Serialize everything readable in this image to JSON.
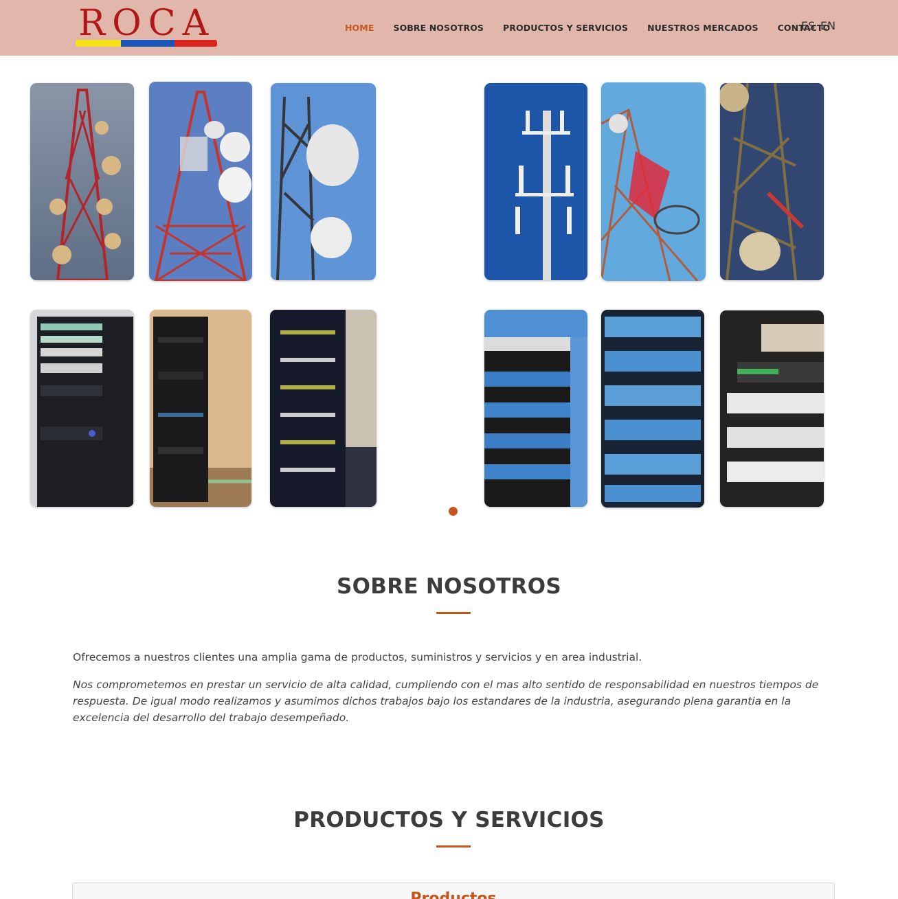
{
  "brand": {
    "logo_text": "ROCA"
  },
  "nav": {
    "items": [
      {
        "label": "HOME",
        "active": true
      },
      {
        "label": "SOBRE NOSOTROS",
        "active": false
      },
      {
        "label": "PRODUCTOS Y SERVICIOS",
        "active": false
      },
      {
        "label": "NUESTROS MERCADOS",
        "active": false
      },
      {
        "label": "CONTACTO",
        "active": false
      }
    ],
    "languages": [
      "ES",
      "EN"
    ]
  },
  "gallery": {
    "groups": [
      {
        "name": "antenna-towers",
        "images": [
          "tower",
          "tower",
          "tower",
          "tower",
          "tower",
          "tower"
        ]
      },
      {
        "name": "network-racks",
        "images": [
          "rack",
          "rack",
          "rack",
          "rack",
          "rack",
          "rack"
        ]
      }
    ],
    "carousel_pages": 1,
    "carousel_active_page": 1
  },
  "about": {
    "title": "SOBRE NOSOTROS",
    "intro": "Ofrecemos a nuestros clientes una amplia gama de productos, suministros y servicios y en area industrial.",
    "commitment": "Nos comprometemos en prestar un servicio de alta calidad, cumpliendo con el mas alto sentido de responsabilidad en nuestros tiempos de respuesta. De igual modo realizamos y asumimos dichos trabajos bajo los estandares de la industria, asegurando plena garantia en la excelencia del desarrollo del trabajo desempeñado."
  },
  "products": {
    "title": "PRODUCTOS Y SERVICIOS",
    "panel_title": "Productos"
  },
  "colors": {
    "header_bg": "#e2b7ab",
    "accent": "#c7561e",
    "logo_red": "#b01818"
  }
}
